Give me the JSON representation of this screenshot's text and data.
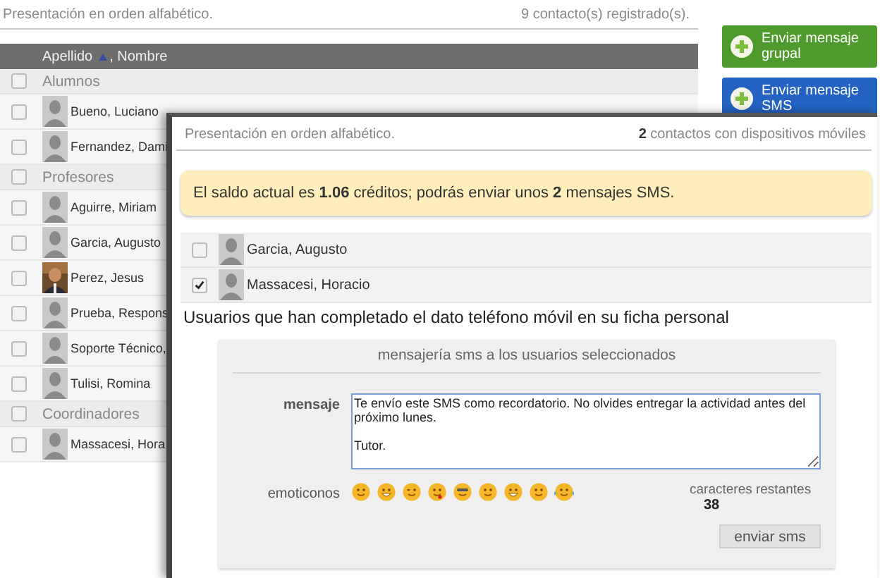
{
  "header": {
    "caption": "Presentación en orden alfabético.",
    "count": "9 contacto(s) registrado(s)."
  },
  "table": {
    "columns": [
      {
        "label": "Apellido",
        "sorted": true
      },
      {
        "label": ", Nombre",
        "sorted": false
      }
    ],
    "rows": [
      {
        "kind": "group",
        "label": "Alumnos",
        "checked": false
      },
      {
        "kind": "contact",
        "name": "Bueno, Luciano",
        "checked": false,
        "photo": false
      },
      {
        "kind": "contact",
        "name": "Fernandez, Dami",
        "checked": false,
        "photo": false
      },
      {
        "kind": "group",
        "label": "Profesores",
        "checked": false
      },
      {
        "kind": "contact",
        "name": "Aguirre, Miriam",
        "checked": false,
        "photo": false
      },
      {
        "kind": "contact",
        "name": "Garcia, Augusto",
        "checked": false,
        "photo": false
      },
      {
        "kind": "contact",
        "name": "Perez, Jesus",
        "checked": false,
        "photo": true
      },
      {
        "kind": "contact",
        "name": "Prueba, Respons",
        "checked": false,
        "photo": false
      },
      {
        "kind": "contact",
        "name": "Soporte Técnico,",
        "checked": false,
        "photo": false
      },
      {
        "kind": "contact",
        "name": "Tulisi, Romina",
        "checked": false,
        "photo": false
      },
      {
        "kind": "group",
        "label": "Coordinadores",
        "checked": false
      },
      {
        "kind": "contact",
        "name": "Massacesi, Hora",
        "checked": false,
        "photo": false
      }
    ]
  },
  "buttons": [
    {
      "label": "Enviar mensaje grupal",
      "color": "#4f9a2c"
    },
    {
      "label": "Enviar mensaje SMS",
      "color": "#2463c2"
    }
  ],
  "dialog": {
    "caption": "Presentación en orden alfabético.",
    "count": "**2** contactos con dispositivos móviles",
    "notice": "El saldo actual es **1.06** créditos; podrás enviar unos **2** mensajes SMS.",
    "contacts": [
      {
        "name": "Garcia, Augusto",
        "checked": false
      },
      {
        "name": "Massacesi, Horacio",
        "checked": true
      }
    ],
    "note": "Usuarios que han completado el dato teléfono móvil en su ficha personal",
    "sms": {
      "title": "mensajería sms a los usuarios seleccionados",
      "message_label": "mensaje",
      "message": "Te envío este SMS como recordatorio. No olvides entregar la actividad antes del próximo lunes.\n\nTutor.",
      "emoticons_label": "emoticonos",
      "remaining_label": "caracteres restantes",
      "remaining": "38",
      "send": "enviar sms"
    }
  }
}
